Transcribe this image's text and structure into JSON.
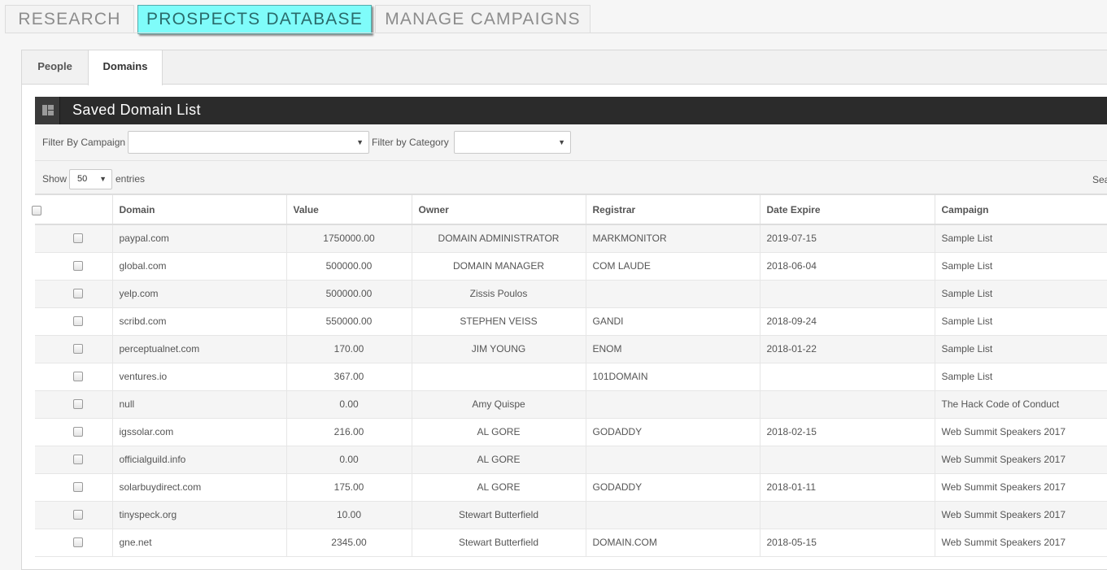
{
  "top_tabs": [
    {
      "label": "RESEARCH"
    },
    {
      "label": "PROSPECTS DATABASE"
    },
    {
      "label": "MANAGE CAMPAIGNS"
    }
  ],
  "sub_tabs": [
    {
      "label": "People"
    },
    {
      "label": "Domains"
    }
  ],
  "box": {
    "title": "Saved Domain List",
    "icon": "layout-icon"
  },
  "filters": {
    "campaign_label": "Filter By Campaign",
    "campaign_value": "",
    "category_label": "Filter by Category",
    "category_value": ""
  },
  "length": {
    "show_label": "Show",
    "value": "50",
    "entries_label": "entries",
    "search_label": "Search:"
  },
  "table": {
    "headers": {
      "domain": "Domain",
      "value": "Value",
      "owner": "Owner",
      "registrar": "Registrar",
      "date_expire": "Date Expire",
      "campaign": "Campaign"
    },
    "rows": [
      {
        "domain": "paypal.com",
        "value": "1750000.00",
        "owner": "DOMAIN ADMINISTRATOR",
        "registrar": "MARKMONITOR",
        "date_expire": "2019-07-15",
        "campaign": "Sample List"
      },
      {
        "domain": "global.com",
        "value": "500000.00",
        "owner": "DOMAIN MANAGER",
        "registrar": "COM LAUDE",
        "date_expire": "2018-06-04",
        "campaign": "Sample List"
      },
      {
        "domain": "yelp.com",
        "value": "500000.00",
        "owner": "Zissis Poulos",
        "registrar": "",
        "date_expire": "",
        "campaign": "Sample List"
      },
      {
        "domain": "scribd.com",
        "value": "550000.00",
        "owner": "STEPHEN VEISS",
        "registrar": "GANDI",
        "date_expire": "2018-09-24",
        "campaign": "Sample List"
      },
      {
        "domain": "perceptualnet.com",
        "value": "170.00",
        "owner": "JIM YOUNG",
        "registrar": "ENOM",
        "date_expire": "2018-01-22",
        "campaign": "Sample List"
      },
      {
        "domain": "ventures.io",
        "value": "367.00",
        "owner": "",
        "registrar": "101DOMAIN",
        "date_expire": "",
        "campaign": "Sample List"
      },
      {
        "domain": "null",
        "value": "0.00",
        "owner": "Amy Quispe",
        "registrar": "",
        "date_expire": "",
        "campaign": "The Hack Code of Conduct"
      },
      {
        "domain": "igssolar.com",
        "value": "216.00",
        "owner": "AL GORE",
        "registrar": "GODADDY",
        "date_expire": "2018-02-15",
        "campaign": "Web Summit Speakers 2017"
      },
      {
        "domain": "officialguild.info",
        "value": "0.00",
        "owner": "AL GORE",
        "registrar": "",
        "date_expire": "",
        "campaign": "Web Summit Speakers 2017"
      },
      {
        "domain": "solarbuydirect.com",
        "value": "175.00",
        "owner": "AL GORE",
        "registrar": "GODADDY",
        "date_expire": "2018-01-11",
        "campaign": "Web Summit Speakers 2017"
      },
      {
        "domain": "tinyspeck.org",
        "value": "10.00",
        "owner": "Stewart Butterfield",
        "registrar": "",
        "date_expire": "",
        "campaign": "Web Summit Speakers 2017"
      },
      {
        "domain": "gne.net",
        "value": "2345.00",
        "owner": "Stewart Butterfield",
        "registrar": "DOMAIN.COM",
        "date_expire": "2018-05-15",
        "campaign": "Web Summit Speakers 2017"
      }
    ]
  },
  "colors": {
    "active_tab": "#7ffcfa",
    "header_bar": "#2b2b2b"
  }
}
